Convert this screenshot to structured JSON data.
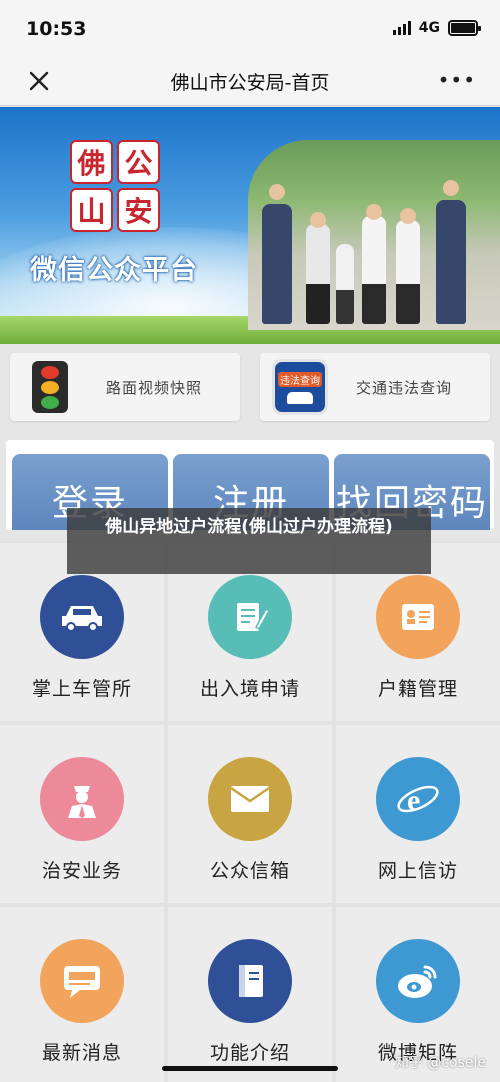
{
  "status": {
    "time": "10:53",
    "network": "4G"
  },
  "nav": {
    "title": "佛山市公安局-首页",
    "more": "•••"
  },
  "banner": {
    "seal_chars": [
      "佛",
      "公",
      "山",
      "安"
    ],
    "title": "微信公众平台"
  },
  "quick_links": [
    {
      "label": "路面视频快照",
      "icon": "traffic-light-icon"
    },
    {
      "label": "交通违法查询",
      "icon": "violation-query-icon",
      "icon_text": "违法查询"
    }
  ],
  "auth": {
    "login": "登录",
    "register": "注册",
    "forgot": "找回密码"
  },
  "caption": "佛山异地过户流程(佛山过户办理流程)",
  "grid": [
    {
      "label": "掌上车管所",
      "icon": "car-icon",
      "color": "#2f4f96"
    },
    {
      "label": "出入境申请",
      "icon": "document-edit-icon",
      "color": "#58bdb6"
    },
    {
      "label": "户籍管理",
      "icon": "id-card-icon",
      "color": "#f2a35c"
    },
    {
      "label": "治安业务",
      "icon": "police-officer-icon",
      "color": "#ec8a9a"
    },
    {
      "label": "公众信箱",
      "icon": "mail-icon",
      "color": "#c9a443"
    },
    {
      "label": "网上信访",
      "icon": "internet-explorer-icon",
      "color": "#3e98d2"
    },
    {
      "label": "最新消息",
      "icon": "news-icon",
      "color": "#f2a35c"
    },
    {
      "label": "功能介绍",
      "icon": "book-icon",
      "color": "#2f4f96"
    },
    {
      "label": "微博矩阵",
      "icon": "weibo-icon",
      "color": "#3e98d2"
    }
  ],
  "watermark": "知乎 @cosele"
}
